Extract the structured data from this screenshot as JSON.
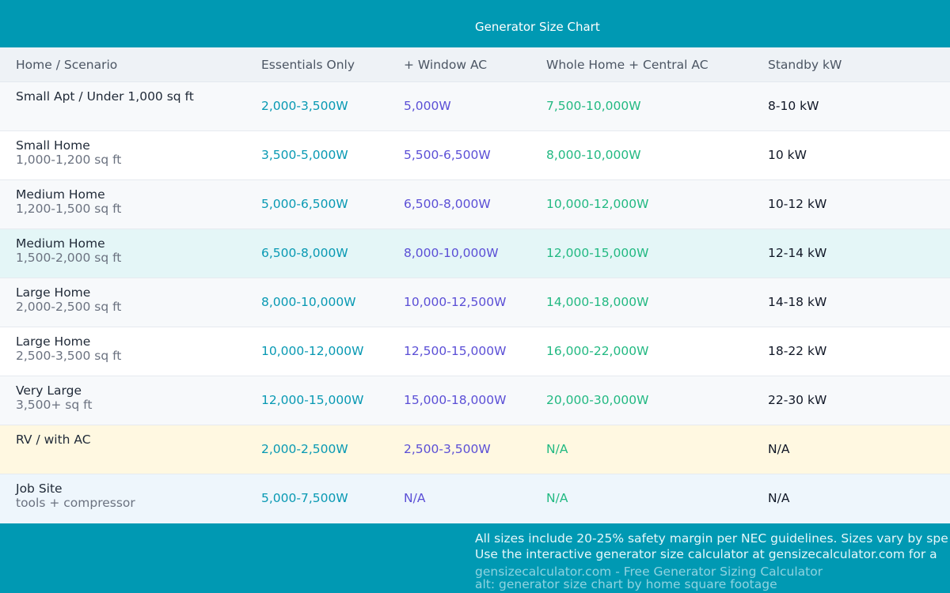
{
  "header": {
    "title": "Generator Size Chart"
  },
  "columns": {
    "scenario": "Home / Scenario",
    "essentials": "Essentials Only",
    "window_ac": "+ Window AC",
    "whole_home": "Whole Home + Central AC",
    "standby": "Standby kW"
  },
  "rows": [
    {
      "name": "Small Apt / Under 1,000 sq ft",
      "sub": "",
      "essentials": "2,000-3,500W",
      "window_ac": "5,000W",
      "whole_home": "7,500-10,000W",
      "standby": "8-10 kW"
    },
    {
      "name": "Small Home",
      "sub": "1,000-1,200 sq ft",
      "essentials": "3,500-5,000W",
      "window_ac": "5,500-6,500W",
      "whole_home": "8,000-10,000W",
      "standby": "10 kW"
    },
    {
      "name": "Medium Home",
      "sub": "1,200-1,500 sq ft",
      "essentials": "5,000-6,500W",
      "window_ac": "6,500-8,000W",
      "whole_home": "10,000-12,000W",
      "standby": "10-12 kW"
    },
    {
      "name": "Medium Home",
      "sub": "1,500-2,000 sq ft",
      "essentials": "6,500-8,000W",
      "window_ac": "8,000-10,000W",
      "whole_home": "12,000-15,000W",
      "standby": "12-14 kW"
    },
    {
      "name": "Large Home",
      "sub": "2,000-2,500 sq ft",
      "essentials": "8,000-10,000W",
      "window_ac": "10,000-12,500W",
      "whole_home": "14,000-18,000W",
      "standby": "14-18 kW"
    },
    {
      "name": "Large Home",
      "sub": "2,500-3,500 sq ft",
      "essentials": "10,000-12,000W",
      "window_ac": "12,500-15,000W",
      "whole_home": "16,000-22,000W",
      "standby": "18-22 kW"
    },
    {
      "name": "Very Large",
      "sub": "3,500+ sq ft",
      "essentials": "12,000-15,000W",
      "window_ac": "15,000-18,000W",
      "whole_home": "20,000-30,000W",
      "standby": "22-30 kW"
    },
    {
      "name": "RV / with AC",
      "sub": "",
      "essentials": "2,000-2,500W",
      "window_ac": "2,500-3,500W",
      "whole_home": "N/A",
      "standby": "N/A"
    },
    {
      "name": "Job Site",
      "sub": "tools + compressor",
      "essentials": "5,000-7,500W",
      "window_ac": "N/A",
      "whole_home": "N/A",
      "standby": "N/A"
    }
  ],
  "footer": {
    "note1": "All sizes include 20-25% safety margin per NEC guidelines. Sizes vary by spe",
    "note2": "Use the interactive generator size calculator at gensizecalculator.com for a",
    "site": "gensizecalculator.com - Free Generator Sizing Calculator",
    "alt": "alt: generator size chart by home square footage"
  },
  "colors": {
    "brand": "#0099b3",
    "essentials": "#0899b3",
    "window_ac": "#5b4fd6",
    "whole_home": "#22b982",
    "standby": "#111827"
  }
}
